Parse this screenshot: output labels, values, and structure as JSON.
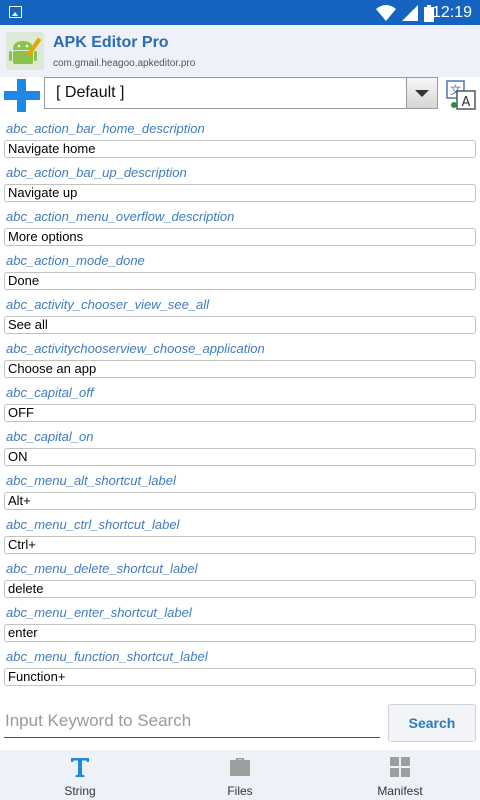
{
  "status_bar": {
    "time": "12:19"
  },
  "app": {
    "title": "APK Editor Pro",
    "package": "com.gmail.heagoo.apkeditor.pro"
  },
  "toolbar": {
    "language_selected": "[ Default ]"
  },
  "strings": [
    {
      "key": "abc_action_bar_home_description",
      "value": "Navigate home"
    },
    {
      "key": "abc_action_bar_up_description",
      "value": "Navigate up"
    },
    {
      "key": "abc_action_menu_overflow_description",
      "value": "More options"
    },
    {
      "key": "abc_action_mode_done",
      "value": "Done"
    },
    {
      "key": "abc_activity_chooser_view_see_all",
      "value": "See all"
    },
    {
      "key": "abc_activitychooserview_choose_application",
      "value": "Choose an app"
    },
    {
      "key": "abc_capital_off",
      "value": "OFF"
    },
    {
      "key": "abc_capital_on",
      "value": "ON"
    },
    {
      "key": "abc_menu_alt_shortcut_label",
      "value": "Alt+"
    },
    {
      "key": "abc_menu_ctrl_shortcut_label",
      "value": "Ctrl+"
    },
    {
      "key": "abc_menu_delete_shortcut_label",
      "value": "delete"
    },
    {
      "key": "abc_menu_enter_shortcut_label",
      "value": "enter"
    },
    {
      "key": "abc_menu_function_shortcut_label",
      "value": "Function+"
    }
  ],
  "search": {
    "placeholder": "Input Keyword to Search",
    "button_label": "Search"
  },
  "tabs": [
    {
      "label": "String",
      "icon": "text-t-icon",
      "active": true
    },
    {
      "label": "Files",
      "icon": "briefcase-icon",
      "active": false
    },
    {
      "label": "Manifest",
      "icon": "grid-icon",
      "active": false
    }
  ],
  "colors": {
    "status_bar": "#1565c0",
    "accent_blue": "#1e88e5",
    "key_text": "#3e7cc2",
    "header_bg": "#eef2f8"
  }
}
